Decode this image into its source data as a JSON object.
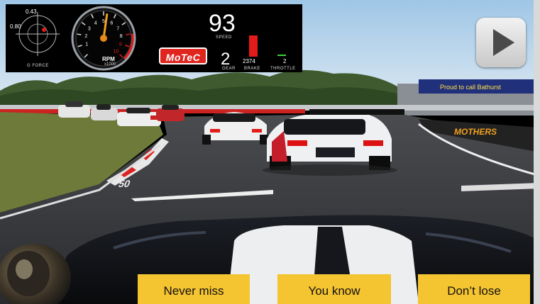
{
  "hud": {
    "gforce": {
      "lateral": "0.43",
      "longitudinal": "0.80",
      "label": "G FORCE"
    },
    "rpm": {
      "label": "RPM",
      "multiplier": "x1000",
      "ticks": [
        "1",
        "2",
        "3",
        "4",
        "5",
        "6",
        "7",
        "8",
        "9",
        "10"
      ]
    },
    "brand": "MoTeC",
    "speed": {
      "value": "93",
      "label": "SPEED"
    },
    "gear": {
      "value": "2",
      "label": "GEAR"
    },
    "brake": {
      "value": "2374",
      "label": "BRAKE"
    },
    "throttle": {
      "value": "2",
      "label": "THROTTLE"
    }
  },
  "promos": [
    {
      "label": "Never miss"
    },
    {
      "label": "You know"
    },
    {
      "label": "Don’t lose"
    }
  ],
  "trackside": {
    "banner": "Proud to call Bathurst",
    "track_marker": "50"
  },
  "icons": {
    "play": "play-icon"
  },
  "colors": {
    "accent": "#f5c431",
    "brand_red": "#e0251e",
    "brake": "#e31b1b",
    "throttle": "#3ecf3e"
  }
}
